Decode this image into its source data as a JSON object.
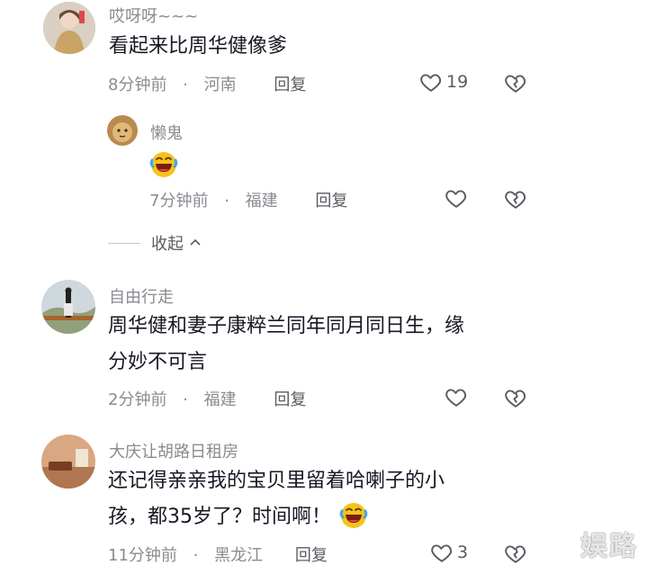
{
  "comments": [
    {
      "username": "哎呀呀~~~",
      "content": "看起来比周华健像爹",
      "time": "8分钟前",
      "dot": "·",
      "location": "河南",
      "reply": "回复",
      "likes": "19",
      "avatar_icon": "user-avatar-girl"
    },
    {
      "username": "懒鬼",
      "time": "7分钟前",
      "dot": "·",
      "location": "福建",
      "reply": "回复",
      "likes": "",
      "avatar_icon": "user-avatar-cat",
      "emoji_icon": "laughing-crying-emoji"
    },
    {
      "username": "自由行走",
      "content_line1": "周华健和妻子康粹兰同年同月同日生，缘",
      "content_line2": "分妙不可言",
      "time": "2分钟前",
      "dot": "·",
      "location": "福建",
      "reply": "回复",
      "likes": "",
      "avatar_icon": "user-avatar-landscape"
    },
    {
      "username": "大庆让胡路日租房",
      "content_line1": "还记得亲亲我的宝贝里留着哈喇子的小",
      "content_line2": "孩，都35岁了？时间啊！",
      "time": "11分钟前",
      "dot": "·",
      "location": "黑龙江",
      "reply": "回复",
      "likes": "3",
      "avatar_icon": "user-avatar-room",
      "emoji_icon": "laughing-crying-emoji"
    }
  ],
  "collapse_label": "收起",
  "watermark": "娱路",
  "colors": {
    "text_primary": "#161823",
    "text_secondary": "#8a8b91",
    "icon": "#5a5b62",
    "emoji": "#f5b400"
  }
}
